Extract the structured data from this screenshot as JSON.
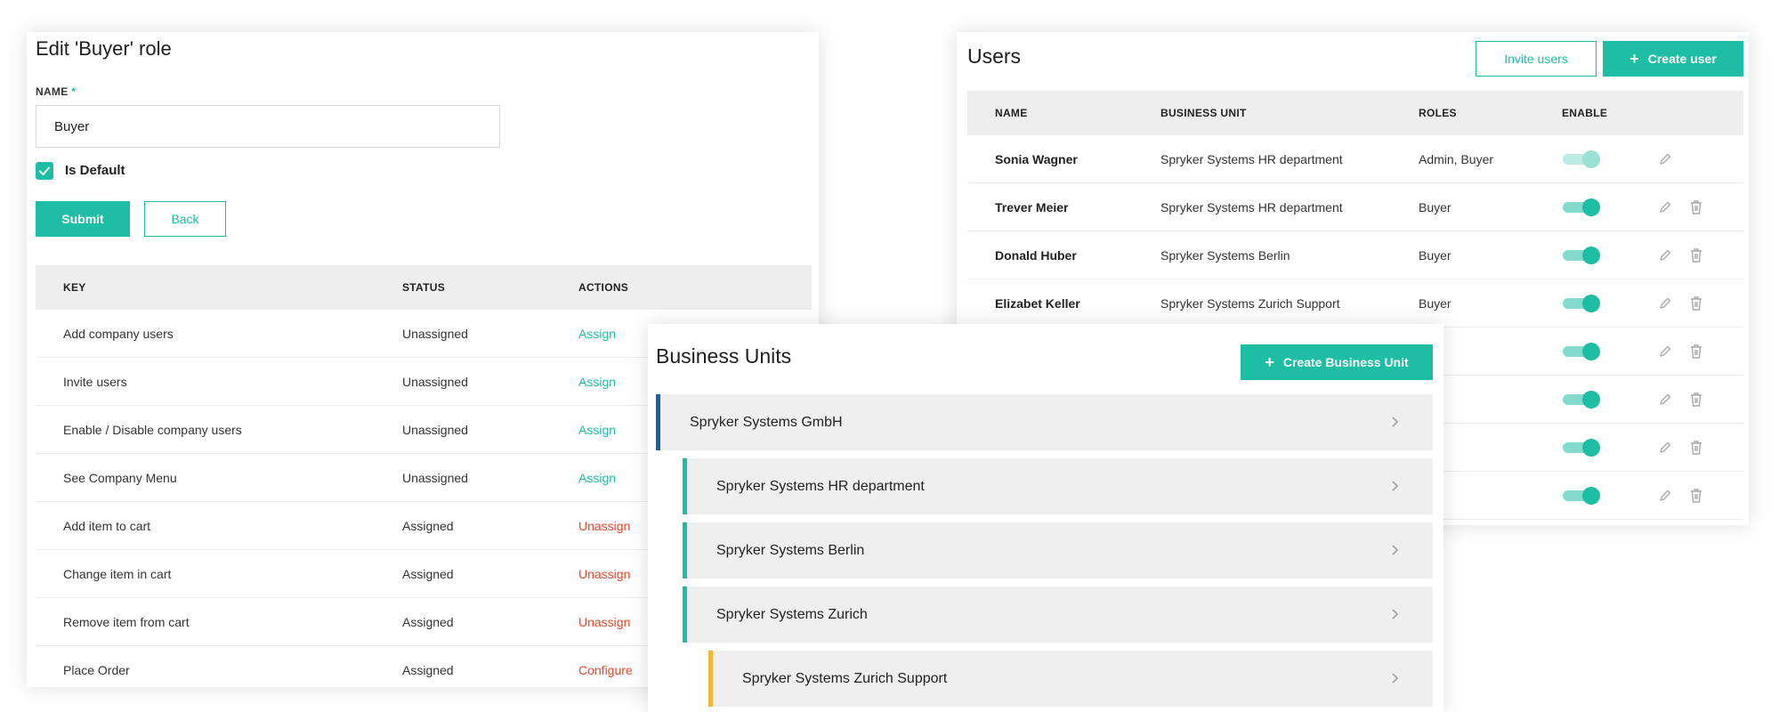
{
  "role_edit": {
    "title": "Edit 'Buyer' role",
    "name_label": "NAME",
    "required_mark": "*",
    "name_value": "Buyer",
    "is_default_label": "Is Default",
    "is_default_checked": true,
    "submit_label": "Submit",
    "back_label": "Back",
    "table": {
      "headers": [
        "KEY",
        "STATUS",
        "ACTIONS"
      ],
      "rows": [
        {
          "key": "Add company users",
          "status": "Unassigned",
          "action": "Assign"
        },
        {
          "key": "Invite users",
          "status": "Unassigned",
          "action": "Assign"
        },
        {
          "key": "Enable / Disable company users",
          "status": "Unassigned",
          "action": "Assign"
        },
        {
          "key": "See Company Menu",
          "status": "Unassigned",
          "action": "Assign"
        },
        {
          "key": "Add item to cart",
          "status": "Assigned",
          "action": "Unassign"
        },
        {
          "key": "Change item in cart",
          "status": "Assigned",
          "action": "Unassign"
        },
        {
          "key": "Remove item from cart",
          "status": "Assigned",
          "action": "Unassign"
        },
        {
          "key": "Place Order",
          "status": "Assigned",
          "action": "Configure"
        }
      ]
    }
  },
  "users": {
    "title": "Users",
    "invite_label": "Invite users",
    "create_label": "Create user",
    "headers": [
      "NAME",
      "BUSINESS UNIT",
      "ROLES",
      "ENABLE"
    ],
    "rows": [
      {
        "name": "Sonia Wagner",
        "unit": "Spryker Systems HR department",
        "roles": "Admin, Buyer",
        "enabled": true,
        "deletable": false
      },
      {
        "name": "Trever Meier",
        "unit": "Spryker Systems HR department",
        "roles": "Buyer",
        "enabled": true,
        "deletable": true
      },
      {
        "name": "Donald Huber",
        "unit": "Spryker Systems Berlin",
        "roles": "Buyer",
        "enabled": true,
        "deletable": true
      },
      {
        "name": "Elizabet Keller",
        "unit": "Spryker Systems Zurich Support",
        "roles": "Buyer",
        "enabled": true,
        "deletable": true
      },
      {
        "name": "",
        "unit": "",
        "roles": "er",
        "enabled": true,
        "deletable": true
      },
      {
        "name": "",
        "unit": "",
        "roles": "er",
        "enabled": true,
        "deletable": true
      },
      {
        "name": "",
        "unit": "",
        "roles": "er",
        "enabled": true,
        "deletable": true
      },
      {
        "name": "",
        "unit": "",
        "roles": "ain",
        "enabled": true,
        "deletable": true
      }
    ]
  },
  "business_units": {
    "title": "Business Units",
    "create_label": "Create Business Unit",
    "items": [
      {
        "label": "Spryker Systems GmbH",
        "level": 0,
        "accent": "#1d5fae"
      },
      {
        "label": "Spryker Systems HR department",
        "level": 1,
        "accent": "#1ebea5"
      },
      {
        "label": "Spryker Systems Berlin",
        "level": 1,
        "accent": "#1ebea5"
      },
      {
        "label": "Spryker Systems Zurich",
        "level": 1,
        "accent": "#1ebea5"
      },
      {
        "label": "Spryker Systems Zurich Support",
        "level": 2,
        "accent": "#f2b736"
      }
    ]
  },
  "colors": {
    "primary": "#1ebea5",
    "danger": "#e8472c",
    "header_bg": "#eeeeee"
  },
  "icons": [
    "check-icon",
    "plus-icon",
    "edit-icon",
    "trash-icon",
    "chevron-right-icon"
  ]
}
